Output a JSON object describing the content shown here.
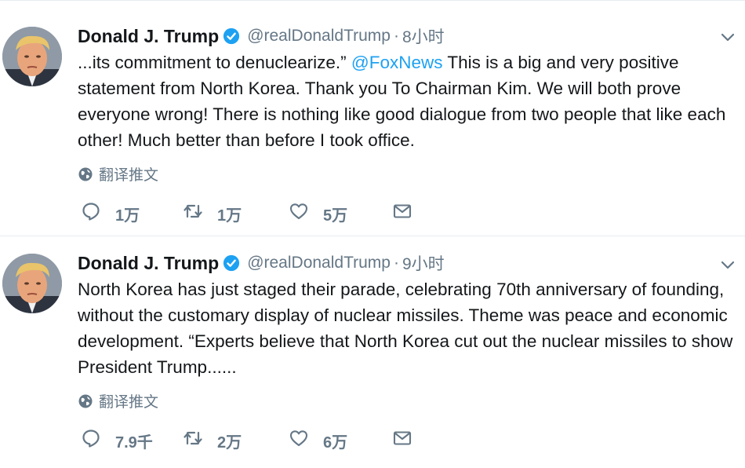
{
  "tweets": [
    {
      "name": "Donald J. Trump",
      "handle": "@realDonaldTrump",
      "dot": "·",
      "time": "8小时",
      "text_before": "...its commitment to denuclearize.” ",
      "mention": "@FoxNews",
      "text_after": "  This is a big and very positive statement from North Korea. Thank you To Chairman Kim. We will both prove everyone wrong! There is nothing like good dialogue from two people that like each other! Much better than before I took office.",
      "translate_label": "翻译推文",
      "replies": "1万",
      "retweets": "1万",
      "likes": "5万"
    },
    {
      "name": "Donald J. Trump",
      "handle": "@realDonaldTrump",
      "dot": "·",
      "time": "9小时",
      "text_before": "North Korea has just staged their parade, celebrating 70th anniversary of founding, without the customary display of nuclear missiles. Theme was peace and economic development. “Experts believe that North Korea cut out the nuclear missiles to show President Trump......",
      "mention": "",
      "text_after": "",
      "translate_label": "翻译推文",
      "replies": "7.9千",
      "retweets": "2万",
      "likes": "6万"
    }
  ],
  "icons": {
    "verified": "verified-badge-icon",
    "caret": "chevron-down-icon",
    "globe": "globe-icon",
    "reply": "reply-icon",
    "retweet": "retweet-icon",
    "like": "heart-icon",
    "message": "envelope-icon"
  },
  "colors": {
    "link": "#1da1f2",
    "secondary_text": "#657786",
    "primary_text": "#14171a",
    "verified": "#1da1f2"
  }
}
